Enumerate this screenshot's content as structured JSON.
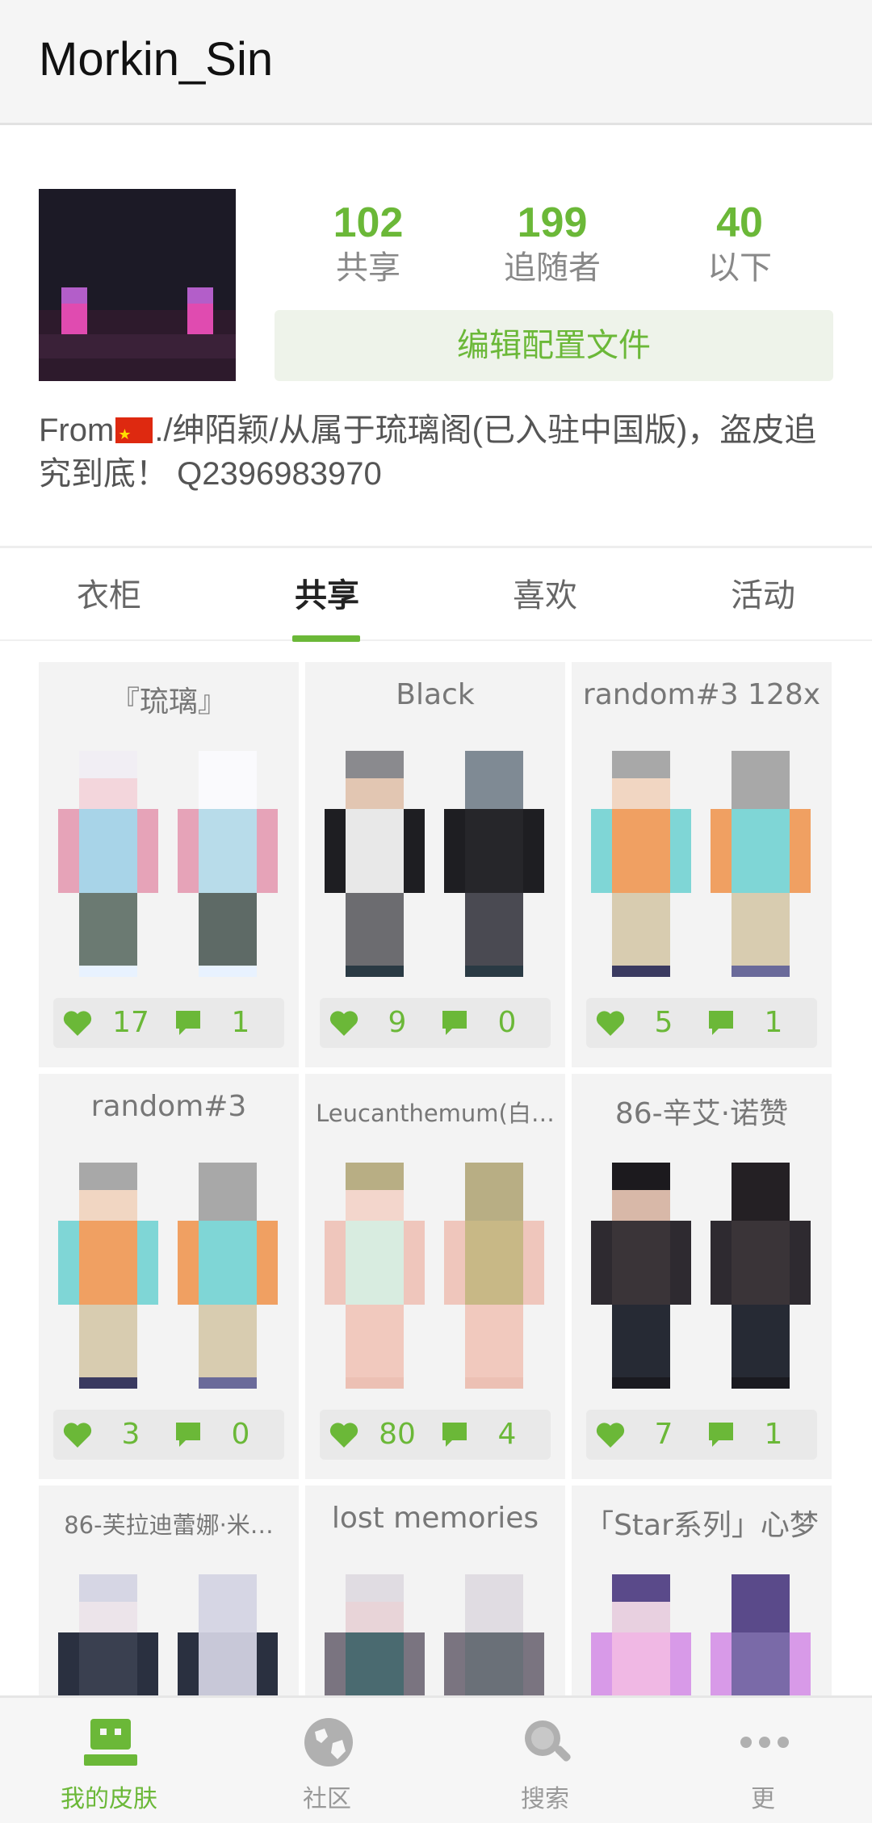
{
  "header": {
    "username": "Morkin_Sin"
  },
  "profile": {
    "stats": [
      {
        "value": "102",
        "label": "共享"
      },
      {
        "value": "199",
        "label": "追随者"
      },
      {
        "value": "40",
        "label": "以下"
      }
    ],
    "edit_button": "编辑配置文件",
    "bio_prefix": "From",
    "bio_rest": "./绅陌颖/从属于琉璃阁(已入驻中国版)，盗皮追究到底！ Q2396983970",
    "accent_color": "#6bb838"
  },
  "tabs": [
    {
      "label": "衣柜"
    },
    {
      "label": "共享"
    },
    {
      "label": "喜欢"
    },
    {
      "label": "活动"
    }
  ],
  "active_tab": "共享",
  "skins": [
    {
      "name": "『琉璃』",
      "likes": "17",
      "comments": "1"
    },
    {
      "name": "Black",
      "likes": "9",
      "comments": "0"
    },
    {
      "name": "random#3 128x",
      "likes": "5",
      "comments": "1"
    },
    {
      "name": "random#3",
      "likes": "3",
      "comments": "0"
    },
    {
      "name": "Leucanthemum(白…",
      "likes": "80",
      "comments": "4"
    },
    {
      "name": "86-辛艾·诺赞",
      "likes": "7",
      "comments": "1"
    },
    {
      "name": "86-芙拉迪蕾娜·米…"
    },
    {
      "name": "lost memories"
    },
    {
      "name": "「Star系列」心梦"
    }
  ],
  "bottom_nav": [
    {
      "label": "我的皮肤",
      "icon": "skin-icon"
    },
    {
      "label": "社区",
      "icon": "globe-icon"
    },
    {
      "label": "搜索",
      "icon": "search-icon"
    },
    {
      "label": "更",
      "icon": "more-icon"
    }
  ],
  "active_nav": "我的皮肤"
}
